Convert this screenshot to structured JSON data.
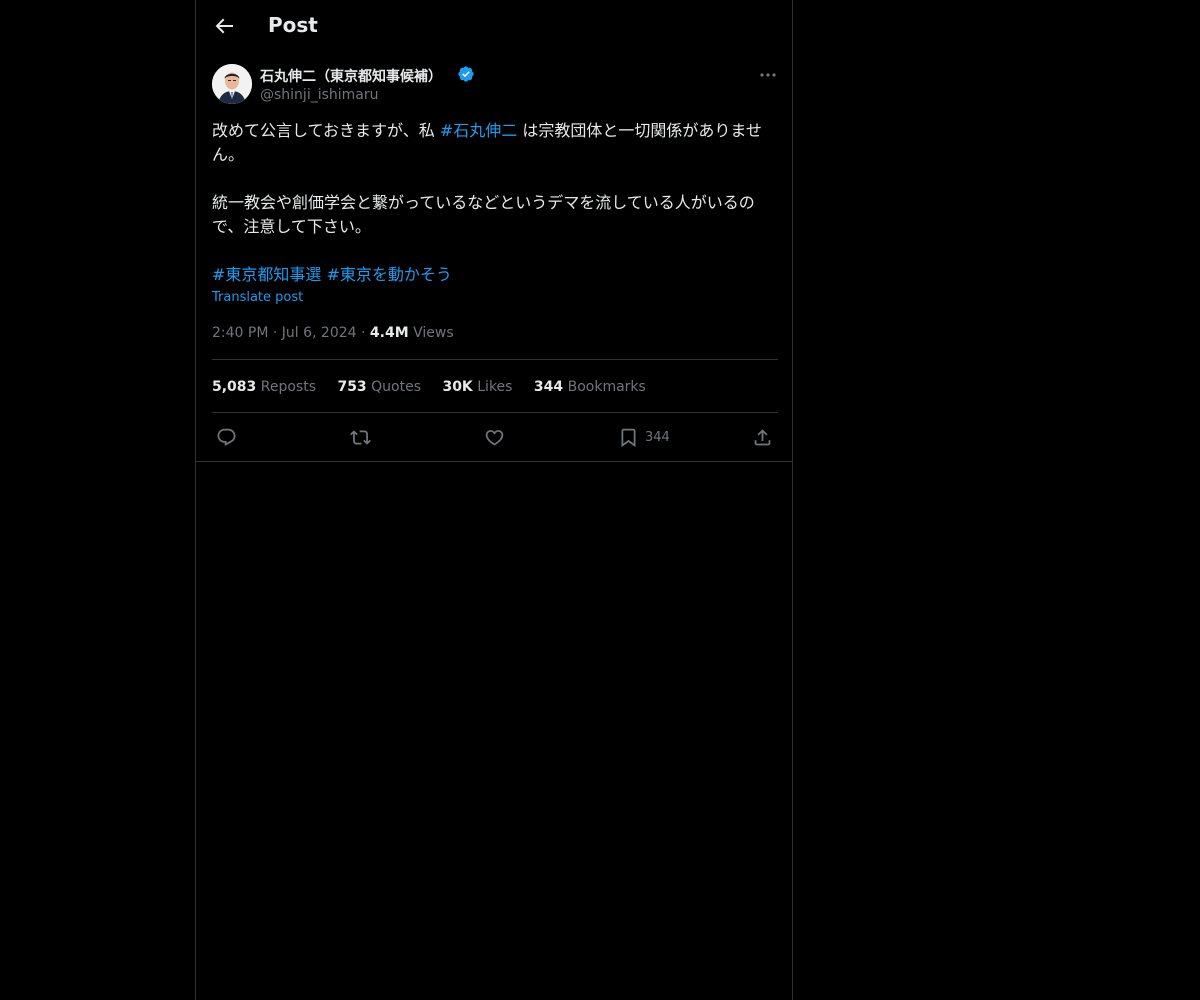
{
  "header": {
    "title": "Post",
    "back_icon": "back-arrow-icon"
  },
  "tweet": {
    "author": {
      "display_name": "石丸伸二（東京都知事候補）",
      "handle": "@shinji_ishimaru",
      "verified": true,
      "avatar": "avatar-photo"
    },
    "body": {
      "line1_pre": "改めて公言しておきますが、私 ",
      "line1_hashtag": "#石丸伸二",
      "line1_post": " は宗教団体と一切関係がありません。",
      "paragraph2": "統一教会や創価学会と繋がっているなどというデマを流している人がいるので、注意して下さい。",
      "hashtags": [
        "#東京都知事選",
        "#東京を動かそう"
      ]
    },
    "translate_label": "Translate post",
    "time": "2:40 PM",
    "date": "Jul 6, 2024",
    "views_count": "4.4M",
    "views_label": "Views",
    "separator": "·"
  },
  "stats": [
    {
      "count": "5,083",
      "label": "Reposts"
    },
    {
      "count": "753",
      "label": "Quotes"
    },
    {
      "count": "30K",
      "label": "Likes"
    },
    {
      "count": "344",
      "label": "Bookmarks"
    }
  ],
  "actions": {
    "reply_icon": "reply-icon",
    "repost_icon": "repost-icon",
    "like_icon": "heart-icon",
    "bookmark_icon": "bookmark-icon",
    "bookmark_count": "344",
    "share_icon": "share-icon"
  },
  "colors": {
    "background": "#000000",
    "text": "#e7e9ea",
    "secondary": "#71767b",
    "accent": "#1d9bf0",
    "border": "#2f3336"
  }
}
